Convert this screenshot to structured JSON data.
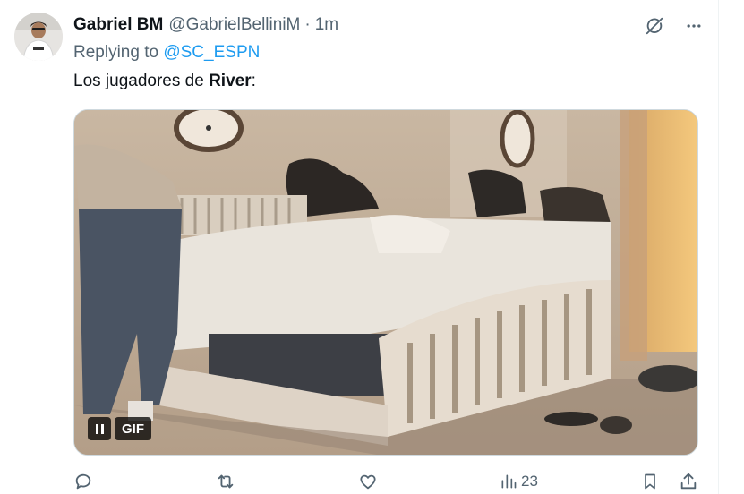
{
  "tweet": {
    "display_name": "Gabriel BM",
    "handle": "@GabrielBelliniM",
    "separator": "·",
    "time": "1m",
    "replying_to_prefix": "Replying to ",
    "replying_to_handle": "@SC_ESPN",
    "text_before": "Los jugadores de ",
    "text_bold": "River",
    "text_after": ":"
  },
  "media": {
    "type": "gif",
    "badge_label": "GIF",
    "state": "playing"
  },
  "actions": {
    "views_count": "23"
  },
  "icons": {
    "grok": "grok-icon",
    "more": "more-icon",
    "reply": "reply-icon",
    "retweet": "retweet-icon",
    "like": "like-icon",
    "views": "views-icon",
    "bookmark": "bookmark-icon",
    "share": "share-icon",
    "pause": "pause-icon"
  },
  "colors": {
    "text": "#0f1419",
    "secondary": "#536471",
    "link": "#1d9bf0"
  }
}
